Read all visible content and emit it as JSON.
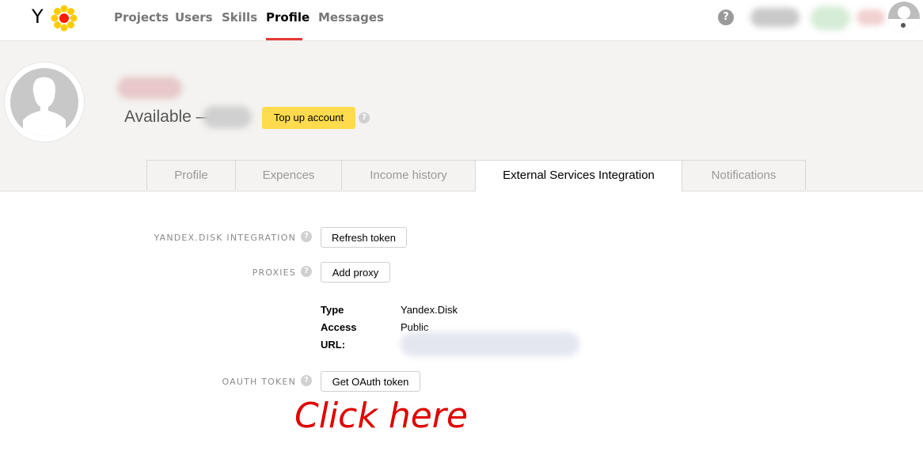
{
  "nav": {
    "items": [
      {
        "label": "Projects",
        "active": false
      },
      {
        "label": "Users",
        "active": false
      },
      {
        "label": "Skills",
        "active": false
      },
      {
        "label": "Profile",
        "active": true
      },
      {
        "label": "Messages",
        "active": false
      }
    ],
    "logo_letter": "Y",
    "help_glyph": "?"
  },
  "profile": {
    "available_label": "Available —",
    "topup_label": "Top up account",
    "help_glyph": "?"
  },
  "tabs": [
    {
      "label": "Profile",
      "active": false
    },
    {
      "label": "Expences",
      "active": false
    },
    {
      "label": "Income history",
      "active": false
    },
    {
      "label": "External Services Integration",
      "active": true
    },
    {
      "label": "Notifications",
      "active": false
    }
  ],
  "integration": {
    "yandex_disk_label": "YANDEX.DISK INTEGRATION",
    "refresh_token_label": "Refresh token",
    "proxies_label": "PROXIES",
    "add_proxy_label": "Add proxy",
    "proxy": {
      "type_key": "Type",
      "type_value": "Yandex.Disk",
      "access_key": "Access",
      "access_value": "Public",
      "url_key": "URL:"
    },
    "oauth_label": "OAUTH TOKEN",
    "get_oauth_label": "Get OAuth token",
    "help_glyph": "?"
  },
  "annotation": {
    "text": "Click here",
    "color": "#e00000"
  },
  "colors": {
    "accent_red": "#e53935",
    "topup_yellow": "#ffdb4d",
    "header_bg": "#f4f3f1"
  }
}
